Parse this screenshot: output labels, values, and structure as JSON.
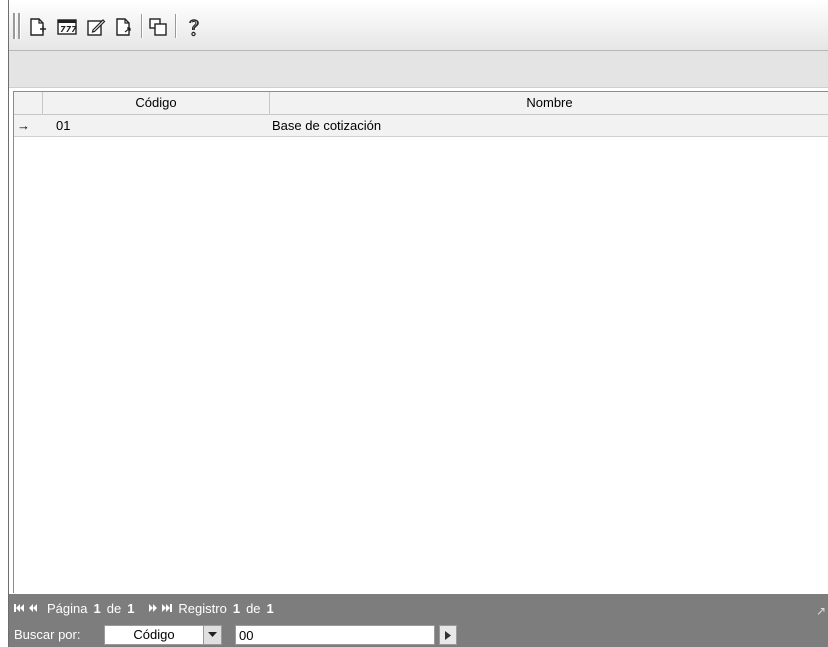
{
  "toolbar": {
    "icons": [
      "new-document-icon",
      "calculator-icon",
      "edit-icon",
      "export-icon",
      "copy-window-icon",
      "help-icon"
    ]
  },
  "grid": {
    "columns": [
      "Código",
      "Nombre"
    ],
    "rows": [
      {
        "indicator": "→",
        "codigo": "01",
        "nombre": "Base de cotización"
      }
    ]
  },
  "footer": {
    "page_label": "Página",
    "page_current": "1",
    "page_of": "de",
    "page_total": "1",
    "record_label": "Registro",
    "record_current": "1",
    "record_of": "de",
    "record_total": "1",
    "first_icon": "⏮",
    "prev_icon": "◀◀",
    "next_icon": "▶▶",
    "last_icon": "⏭"
  },
  "search": {
    "label": "Buscar por:",
    "field_selected": "Código",
    "value": "00"
  },
  "colors": {
    "footer_bg": "#7d7d7d",
    "toolbar_bg": "#f0f0f0",
    "row_bg": "#f2f2f2"
  }
}
